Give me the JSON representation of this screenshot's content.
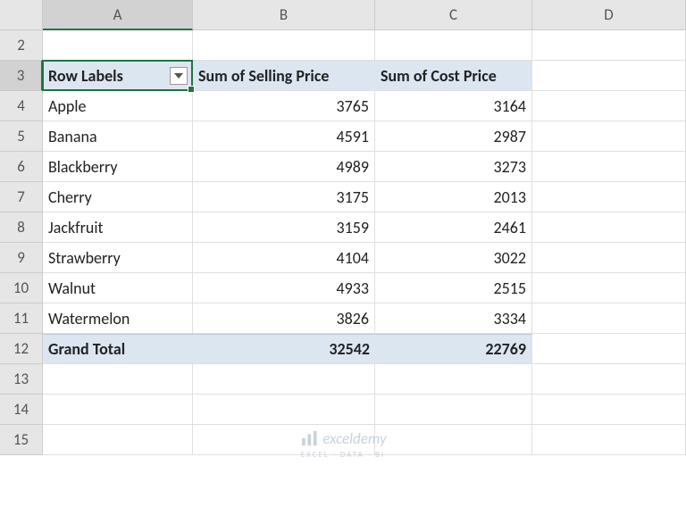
{
  "columns": [
    "A",
    "B",
    "C",
    "D"
  ],
  "visibleRows": [
    2,
    3,
    4,
    5,
    6,
    7,
    8,
    9,
    10,
    11,
    12,
    13,
    14,
    15
  ],
  "activeCell": {
    "col": 0,
    "row": 3
  },
  "pivot": {
    "header": {
      "rowLabels": "Row Labels",
      "sumSelling": "Sum of Selling Price",
      "sumCost": "Sum of Cost Price"
    },
    "rows": [
      {
        "label": "Apple",
        "selling": "3765",
        "cost": "3164"
      },
      {
        "label": "Banana",
        "selling": "4591",
        "cost": "2987"
      },
      {
        "label": "Blackberry",
        "selling": "4989",
        "cost": "3273"
      },
      {
        "label": "Cherry",
        "selling": "3175",
        "cost": "2013"
      },
      {
        "label": "Jackfruit",
        "selling": "3159",
        "cost": "2461"
      },
      {
        "label": "Strawberry",
        "selling": "4104",
        "cost": "3022"
      },
      {
        "label": "Walnut",
        "selling": "4933",
        "cost": "2515"
      },
      {
        "label": "Watermelon",
        "selling": "3826",
        "cost": "3334"
      }
    ],
    "grandTotal": {
      "label": "Grand Total",
      "selling": "32542",
      "cost": "22769"
    }
  },
  "watermark": {
    "brand": "exceldemy",
    "tagline": "EXCEL · DATA · BI"
  }
}
